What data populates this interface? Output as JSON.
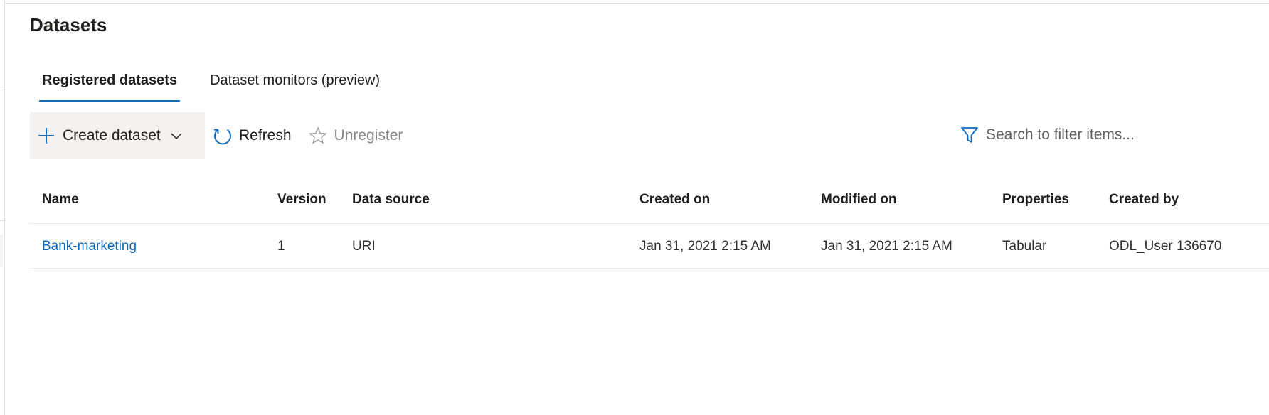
{
  "page": {
    "title": "Datasets"
  },
  "tabs": [
    {
      "label": "Registered datasets",
      "active": true
    },
    {
      "label": "Dataset monitors (preview)",
      "active": false
    }
  ],
  "toolbar": {
    "create_label": "Create dataset",
    "refresh_label": "Refresh",
    "unregister_label": "Unregister"
  },
  "search": {
    "placeholder": "Search to filter items..."
  },
  "grid": {
    "columns": [
      "Name",
      "Version",
      "Data source",
      "Created on",
      "Modified on",
      "Properties",
      "Created by"
    ],
    "rows": [
      {
        "name": "Bank-marketing",
        "version": "1",
        "data_source": "URI",
        "created_on": "Jan 31, 2021 2:15 AM",
        "modified_on": "Jan 31, 2021 2:15 AM",
        "properties": "Tabular",
        "created_by": "ODL_User 136670"
      }
    ]
  },
  "icons": {
    "create": "plus-icon",
    "create_menu": "chevron-down-icon",
    "refresh": "refresh-icon",
    "unregister": "star-icon",
    "search": "filter-icon"
  },
  "colors": {
    "accent": "#0f6cbd",
    "link": "#0f6cbd",
    "button_bg": "#f3f2f1",
    "disabled_text": "#8a8886"
  }
}
